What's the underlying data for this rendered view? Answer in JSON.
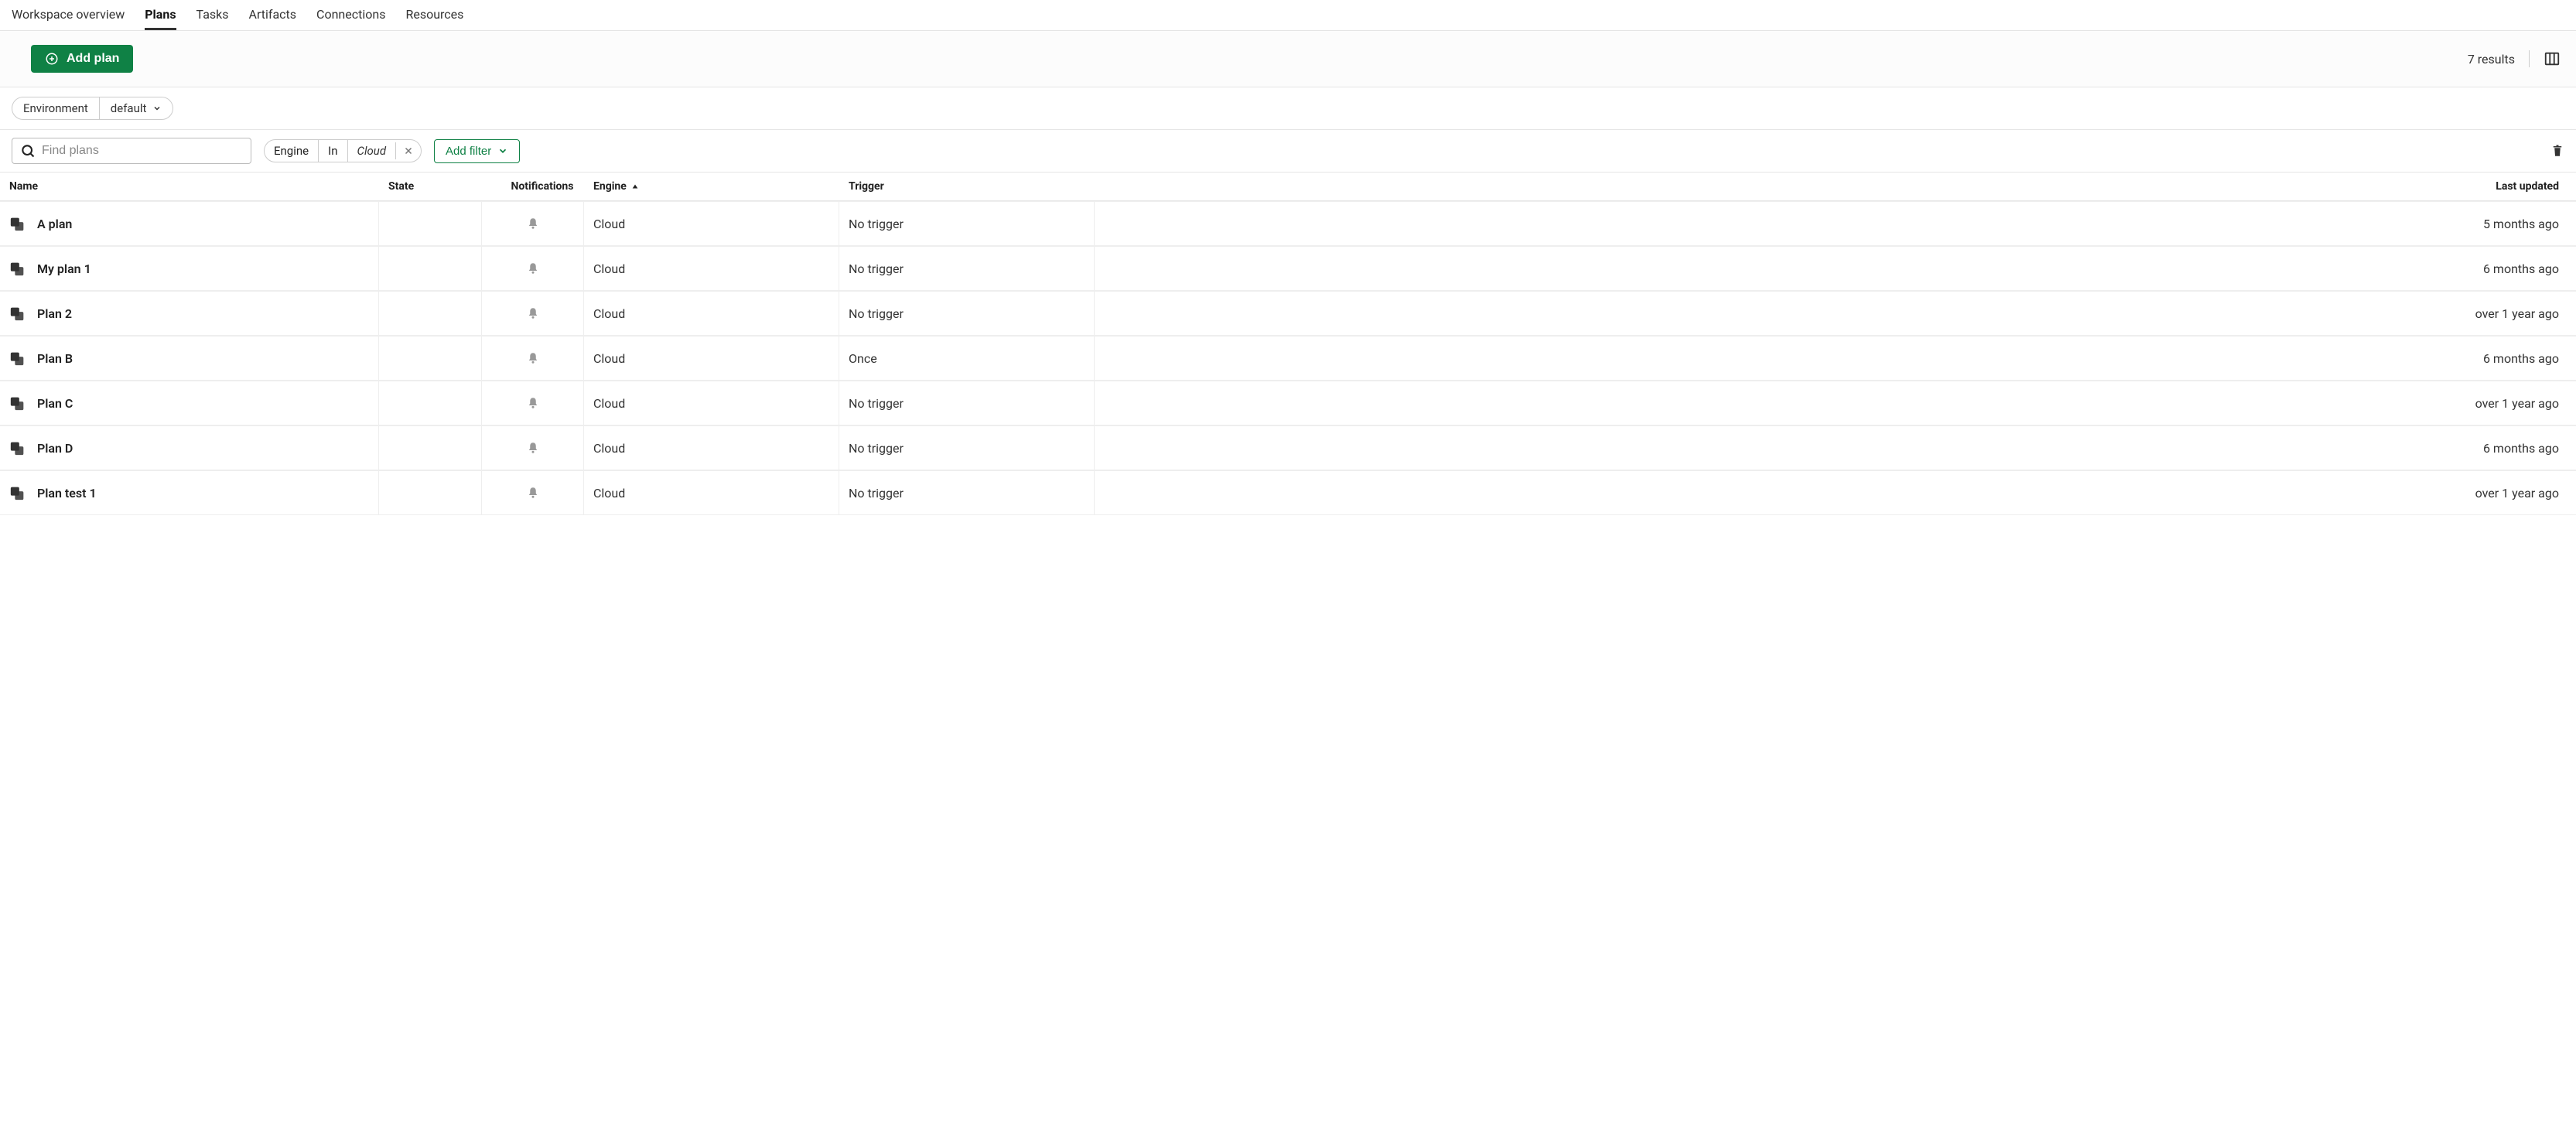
{
  "tabs": [
    "Workspace overview",
    "Plans",
    "Tasks",
    "Artifacts",
    "Connections",
    "Resources"
  ],
  "active_tab": "Plans",
  "toolbar": {
    "add_plan_label": "Add plan",
    "results_label": "7 results"
  },
  "environment": {
    "label": "Environment",
    "value": "default"
  },
  "search": {
    "placeholder": "Find plans"
  },
  "filter_chip": {
    "field": "Engine",
    "op": "In",
    "value": "Cloud"
  },
  "add_filter_label": "Add filter",
  "columns": [
    "Name",
    "State",
    "Notifications",
    "Engine",
    "Trigger",
    "Last updated"
  ],
  "sort_column": "Engine",
  "rows": [
    {
      "name": "A plan",
      "state": "",
      "engine": "Cloud",
      "trigger": "No trigger",
      "updated": "5 months ago"
    },
    {
      "name": "My plan 1",
      "state": "",
      "engine": "Cloud",
      "trigger": "No trigger",
      "updated": "6 months ago"
    },
    {
      "name": "Plan 2",
      "state": "",
      "engine": "Cloud",
      "trigger": "No trigger",
      "updated": "over 1 year ago"
    },
    {
      "name": "Plan B",
      "state": "",
      "engine": "Cloud",
      "trigger": "Once",
      "updated": "6 months ago"
    },
    {
      "name": "Plan C",
      "state": "",
      "engine": "Cloud",
      "trigger": "No trigger",
      "updated": "over 1 year ago"
    },
    {
      "name": "Plan D",
      "state": "",
      "engine": "Cloud",
      "trigger": "No trigger",
      "updated": "6 months ago"
    },
    {
      "name": "Plan test 1",
      "state": "",
      "engine": "Cloud",
      "trigger": "No trigger",
      "updated": "over 1 year ago"
    }
  ]
}
